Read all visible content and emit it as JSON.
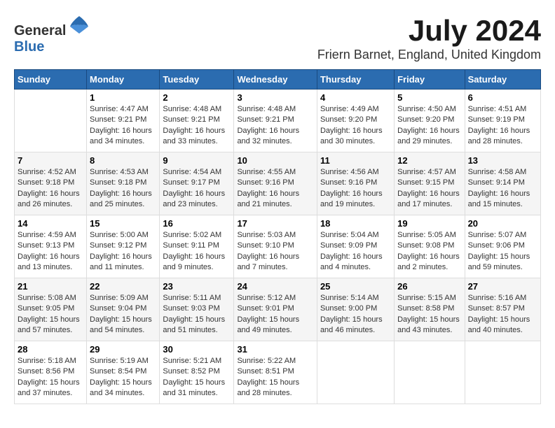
{
  "logo": {
    "text_general": "General",
    "text_blue": "Blue"
  },
  "title": "July 2024",
  "subtitle": "Friern Barnet, England, United Kingdom",
  "days_of_week": [
    "Sunday",
    "Monday",
    "Tuesday",
    "Wednesday",
    "Thursday",
    "Friday",
    "Saturday"
  ],
  "weeks": [
    [
      {
        "day": "",
        "sunrise": "",
        "sunset": "",
        "daylight": ""
      },
      {
        "day": "1",
        "sunrise": "Sunrise: 4:47 AM",
        "sunset": "Sunset: 9:21 PM",
        "daylight": "Daylight: 16 hours and 34 minutes."
      },
      {
        "day": "2",
        "sunrise": "Sunrise: 4:48 AM",
        "sunset": "Sunset: 9:21 PM",
        "daylight": "Daylight: 16 hours and 33 minutes."
      },
      {
        "day": "3",
        "sunrise": "Sunrise: 4:48 AM",
        "sunset": "Sunset: 9:21 PM",
        "daylight": "Daylight: 16 hours and 32 minutes."
      },
      {
        "day": "4",
        "sunrise": "Sunrise: 4:49 AM",
        "sunset": "Sunset: 9:20 PM",
        "daylight": "Daylight: 16 hours and 30 minutes."
      },
      {
        "day": "5",
        "sunrise": "Sunrise: 4:50 AM",
        "sunset": "Sunset: 9:20 PM",
        "daylight": "Daylight: 16 hours and 29 minutes."
      },
      {
        "day": "6",
        "sunrise": "Sunrise: 4:51 AM",
        "sunset": "Sunset: 9:19 PM",
        "daylight": "Daylight: 16 hours and 28 minutes."
      }
    ],
    [
      {
        "day": "7",
        "sunrise": "Sunrise: 4:52 AM",
        "sunset": "Sunset: 9:18 PM",
        "daylight": "Daylight: 16 hours and 26 minutes."
      },
      {
        "day": "8",
        "sunrise": "Sunrise: 4:53 AM",
        "sunset": "Sunset: 9:18 PM",
        "daylight": "Daylight: 16 hours and 25 minutes."
      },
      {
        "day": "9",
        "sunrise": "Sunrise: 4:54 AM",
        "sunset": "Sunset: 9:17 PM",
        "daylight": "Daylight: 16 hours and 23 minutes."
      },
      {
        "day": "10",
        "sunrise": "Sunrise: 4:55 AM",
        "sunset": "Sunset: 9:16 PM",
        "daylight": "Daylight: 16 hours and 21 minutes."
      },
      {
        "day": "11",
        "sunrise": "Sunrise: 4:56 AM",
        "sunset": "Sunset: 9:16 PM",
        "daylight": "Daylight: 16 hours and 19 minutes."
      },
      {
        "day": "12",
        "sunrise": "Sunrise: 4:57 AM",
        "sunset": "Sunset: 9:15 PM",
        "daylight": "Daylight: 16 hours and 17 minutes."
      },
      {
        "day": "13",
        "sunrise": "Sunrise: 4:58 AM",
        "sunset": "Sunset: 9:14 PM",
        "daylight": "Daylight: 16 hours and 15 minutes."
      }
    ],
    [
      {
        "day": "14",
        "sunrise": "Sunrise: 4:59 AM",
        "sunset": "Sunset: 9:13 PM",
        "daylight": "Daylight: 16 hours and 13 minutes."
      },
      {
        "day": "15",
        "sunrise": "Sunrise: 5:00 AM",
        "sunset": "Sunset: 9:12 PM",
        "daylight": "Daylight: 16 hours and 11 minutes."
      },
      {
        "day": "16",
        "sunrise": "Sunrise: 5:02 AM",
        "sunset": "Sunset: 9:11 PM",
        "daylight": "Daylight: 16 hours and 9 minutes."
      },
      {
        "day": "17",
        "sunrise": "Sunrise: 5:03 AM",
        "sunset": "Sunset: 9:10 PM",
        "daylight": "Daylight: 16 hours and 7 minutes."
      },
      {
        "day": "18",
        "sunrise": "Sunrise: 5:04 AM",
        "sunset": "Sunset: 9:09 PM",
        "daylight": "Daylight: 16 hours and 4 minutes."
      },
      {
        "day": "19",
        "sunrise": "Sunrise: 5:05 AM",
        "sunset": "Sunset: 9:08 PM",
        "daylight": "Daylight: 16 hours and 2 minutes."
      },
      {
        "day": "20",
        "sunrise": "Sunrise: 5:07 AM",
        "sunset": "Sunset: 9:06 PM",
        "daylight": "Daylight: 15 hours and 59 minutes."
      }
    ],
    [
      {
        "day": "21",
        "sunrise": "Sunrise: 5:08 AM",
        "sunset": "Sunset: 9:05 PM",
        "daylight": "Daylight: 15 hours and 57 minutes."
      },
      {
        "day": "22",
        "sunrise": "Sunrise: 5:09 AM",
        "sunset": "Sunset: 9:04 PM",
        "daylight": "Daylight: 15 hours and 54 minutes."
      },
      {
        "day": "23",
        "sunrise": "Sunrise: 5:11 AM",
        "sunset": "Sunset: 9:03 PM",
        "daylight": "Daylight: 15 hours and 51 minutes."
      },
      {
        "day": "24",
        "sunrise": "Sunrise: 5:12 AM",
        "sunset": "Sunset: 9:01 PM",
        "daylight": "Daylight: 15 hours and 49 minutes."
      },
      {
        "day": "25",
        "sunrise": "Sunrise: 5:14 AM",
        "sunset": "Sunset: 9:00 PM",
        "daylight": "Daylight: 15 hours and 46 minutes."
      },
      {
        "day": "26",
        "sunrise": "Sunrise: 5:15 AM",
        "sunset": "Sunset: 8:58 PM",
        "daylight": "Daylight: 15 hours and 43 minutes."
      },
      {
        "day": "27",
        "sunrise": "Sunrise: 5:16 AM",
        "sunset": "Sunset: 8:57 PM",
        "daylight": "Daylight: 15 hours and 40 minutes."
      }
    ],
    [
      {
        "day": "28",
        "sunrise": "Sunrise: 5:18 AM",
        "sunset": "Sunset: 8:56 PM",
        "daylight": "Daylight: 15 hours and 37 minutes."
      },
      {
        "day": "29",
        "sunrise": "Sunrise: 5:19 AM",
        "sunset": "Sunset: 8:54 PM",
        "daylight": "Daylight: 15 hours and 34 minutes."
      },
      {
        "day": "30",
        "sunrise": "Sunrise: 5:21 AM",
        "sunset": "Sunset: 8:52 PM",
        "daylight": "Daylight: 15 hours and 31 minutes."
      },
      {
        "day": "31",
        "sunrise": "Sunrise: 5:22 AM",
        "sunset": "Sunset: 8:51 PM",
        "daylight": "Daylight: 15 hours and 28 minutes."
      },
      {
        "day": "",
        "sunrise": "",
        "sunset": "",
        "daylight": ""
      },
      {
        "day": "",
        "sunrise": "",
        "sunset": "",
        "daylight": ""
      },
      {
        "day": "",
        "sunrise": "",
        "sunset": "",
        "daylight": ""
      }
    ]
  ]
}
